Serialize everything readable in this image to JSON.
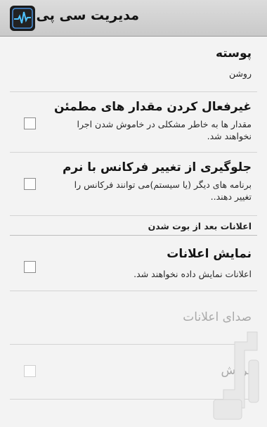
{
  "app": {
    "title": "مدیریت سی پی یو",
    "icon": "cpu-pulse-icon"
  },
  "preferences": {
    "skin": {
      "title": "پوسته",
      "summary": "روشن"
    },
    "disable_unsafe": {
      "title": "غیرفعال کردن مقدار های مطمئن",
      "summary": "مقدار ها به خاطر مشکلی در خاموش شدن اجرا نخواهند شد.",
      "checked": false
    },
    "prevent_change": {
      "title": "جلوگیری از تغییر فرکانس با نرم",
      "summary": "برنامه های دیگر (یا سیستم)می توانند فرکانس را تغییر دهند..",
      "checked": false
    }
  },
  "category": {
    "label": "اعلانات بعد از بوت شدن"
  },
  "notifications": {
    "show": {
      "title": "نمایش اعلانات",
      "summary": "اعلانات نمایش داده نخواهند شد.",
      "checked": false
    },
    "sound": {
      "title": "صدای اعلانات"
    },
    "vibrate": {
      "title": "لرزش"
    }
  },
  "watermark": {
    "icon": "bazaar-logo-icon"
  }
}
